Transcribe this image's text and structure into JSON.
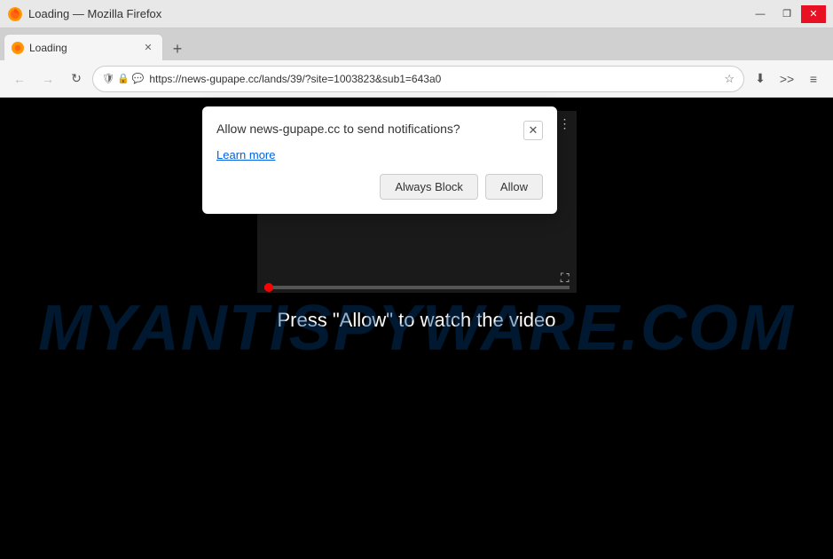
{
  "titlebar": {
    "title": "Loading — Mozilla Firefox",
    "minimize_label": "—",
    "restore_label": "❐",
    "close_label": "✕"
  },
  "tab": {
    "label": "Loading",
    "close_label": "✕"
  },
  "new_tab_label": "+",
  "navbar": {
    "back_label": "←",
    "forward_label": "→",
    "reload_label": "↻",
    "url": "https://news-gupape.cc/lands/39/?site=1003823&sub1=643a0",
    "shield_icon": "🛡",
    "lock_icon": "🔒",
    "message_icon": "💬",
    "star_label": "☆",
    "download_label": "⬇",
    "menu_label": "≡",
    "overflow_label": ">>"
  },
  "watermark": {
    "text": "MYANTISPYWARE.COM"
  },
  "video": {
    "prev_label": "⏮",
    "play_label": "▶",
    "next_label": "⏭",
    "fullscreen_label": "⛶",
    "chevron_label": "∨",
    "list_icon": "≡",
    "share_icon": "↗",
    "more_icon": "⋮"
  },
  "press_allow_text": "Press \"Allow\" to watch the video",
  "popup": {
    "title": "Allow news-gupape.cc to send notifications?",
    "close_label": "✕",
    "learn_more_label": "Learn more",
    "always_block_label": "Always Block",
    "allow_label": "Allow"
  }
}
